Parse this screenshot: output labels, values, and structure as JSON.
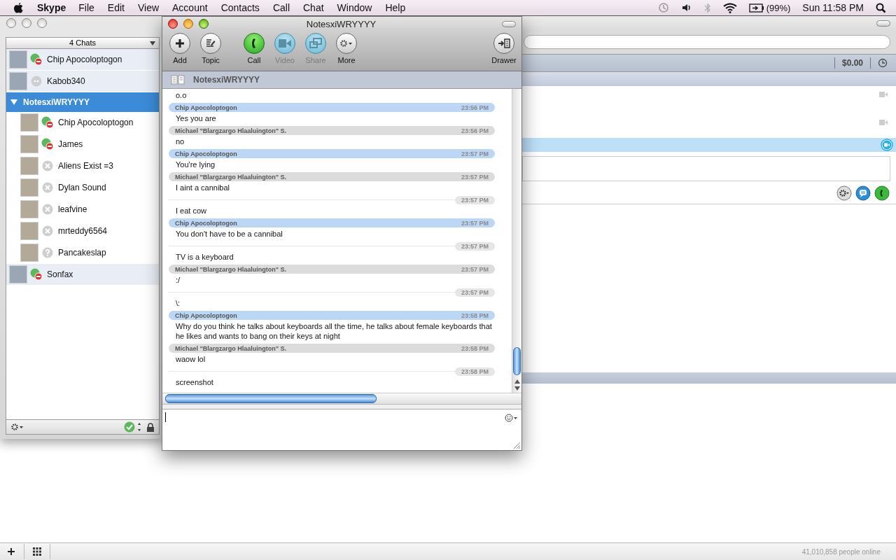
{
  "menubar": {
    "app": "Skype",
    "menus": [
      "File",
      "Edit",
      "View",
      "Account",
      "Contacts",
      "Call",
      "Chat",
      "Window",
      "Help"
    ],
    "battery": "(99%)",
    "clock": "Sun 11:58 PM"
  },
  "main_window": {
    "balance": "$0.00",
    "status": "41,010,858 people online"
  },
  "chats_window": {
    "header": "4 Chats",
    "items": [
      {
        "kind": "dnd",
        "name": "Chip Apocoloptogon",
        "selected": false
      },
      {
        "kind": "idle",
        "name": "Kabob340",
        "selected": false
      },
      {
        "kind": "group",
        "name": "NotesxiWRYYYY",
        "expanded": true,
        "selected": true,
        "children": [
          {
            "kind": "dnd",
            "name": "Chip Apocoloptogon"
          },
          {
            "kind": "dnd",
            "name": "James"
          },
          {
            "kind": "offline",
            "name": "Aliens Exist =3"
          },
          {
            "kind": "offline",
            "name": "Dylan Sound"
          },
          {
            "kind": "offline",
            "name": "leafvine"
          },
          {
            "kind": "offline",
            "name": "mrteddy6564"
          },
          {
            "kind": "unknown",
            "name": "Pancakeslap"
          }
        ]
      },
      {
        "kind": "dnd",
        "name": "Sonfax",
        "selected": false
      }
    ]
  },
  "chat_window": {
    "title": "NotesxiWRYYYY",
    "topic": "NotesxiWRYYYY",
    "toolbar": [
      {
        "kind": "add",
        "label": "Add",
        "disabled": false
      },
      {
        "kind": "topic",
        "label": "Topic",
        "disabled": false
      },
      {
        "kind": "call",
        "label": "Call",
        "disabled": false
      },
      {
        "kind": "video",
        "label": "Video",
        "disabled": true
      },
      {
        "kind": "share",
        "label": "Share",
        "disabled": true
      },
      {
        "kind": "more",
        "label": "More",
        "disabled": false
      },
      {
        "kind": "drawer",
        "label": "Drawer",
        "disabled": false
      }
    ],
    "messages": [
      {
        "kind": "plain",
        "text": "o.o"
      },
      {
        "kind": "sender",
        "sender": "Chip Apocoloptogon",
        "color": "#bcd6f5",
        "time": "23:56 PM",
        "text": "Yes you are"
      },
      {
        "kind": "sender",
        "sender": "Michael \"Blargzargo Hlaaluington\" S.",
        "color": "#dcdcdc",
        "time": "23:56 PM",
        "text": "no"
      },
      {
        "kind": "sender",
        "sender": "Chip Apocoloptogon",
        "color": "#bcd6f5",
        "time": "23:57 PM",
        "text": "You're lying"
      },
      {
        "kind": "sender",
        "sender": "Michael \"Blargzargo Hlaaluington\" S.",
        "color": "#dcdcdc",
        "time": "23:57 PM",
        "text": "I aint a cannibal"
      },
      {
        "kind": "followup",
        "time": "23:57 PM",
        "text": "I eat cow"
      },
      {
        "kind": "sender",
        "sender": "Chip Apocoloptogon",
        "color": "#bcd6f5",
        "time": "23:57 PM",
        "text": "You don't have to be a cannibal"
      },
      {
        "kind": "followup",
        "time": "23:57 PM",
        "text": "TV is a keyboard"
      },
      {
        "kind": "sender",
        "sender": "Michael \"Blargzargo Hlaaluington\" S.",
        "color": "#dcdcdc",
        "time": "23:57 PM",
        "text": ":/"
      },
      {
        "kind": "followup",
        "time": "23:57 PM",
        "text": "\\:"
      },
      {
        "kind": "sender",
        "sender": "Chip Apocoloptogon",
        "color": "#bcd6f5",
        "time": "23:58 PM",
        "text": "Why do you think he talks about keyboards all the time, he talks about female keyboards that he likes and wants to bang on their keys at night"
      },
      {
        "kind": "sender",
        "sender": "Michael \"Blargzargo Hlaaluington\" S.",
        "color": "#dcdcdc",
        "time": "23:58 PM",
        "text": "waow lol"
      },
      {
        "kind": "followup",
        "time": "23:58 PM",
        "text": "screenshot"
      }
    ]
  }
}
